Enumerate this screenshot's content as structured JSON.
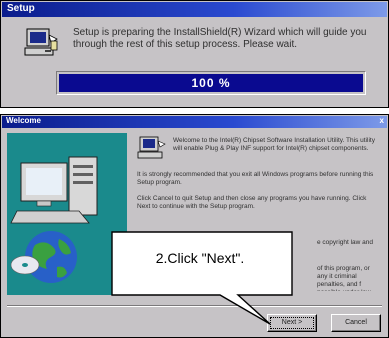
{
  "setup_dialog": {
    "title": "Setup",
    "message": "Setup is preparing the InstallShield(R) Wizard which will guide you through the rest of this setup process. Please wait.",
    "progress_text": "100 %",
    "progress": 1.0
  },
  "welcome_dialog": {
    "title": "Welcome",
    "close_glyph": "x",
    "intro": "Welcome to the Intel(R) Chipset Software Installation Utility. This utility will enable Plug & Play INF support for Intel(R) chipset components.",
    "recommend": "It is strongly recommended that you exit all Windows programs before running this Setup program.",
    "cancel_hint": "Click Cancel to quit Setup and then close any programs you have running. Click Next to continue with the Setup program.",
    "warning_tail_1": "e copyright law and",
    "warning_tail_2": "of this program, or any it criminal penalties, and f possible under law.",
    "next_label": "Next >",
    "cancel_label": "Cancel"
  },
  "callout": {
    "text": "2.Click \"Next\"."
  },
  "colors": {
    "dialog_bg": "#c6c3c6",
    "titlebar": "#0a1c8c",
    "progress_fill": "#0a0a90",
    "side_art": "#1a8a8c"
  }
}
